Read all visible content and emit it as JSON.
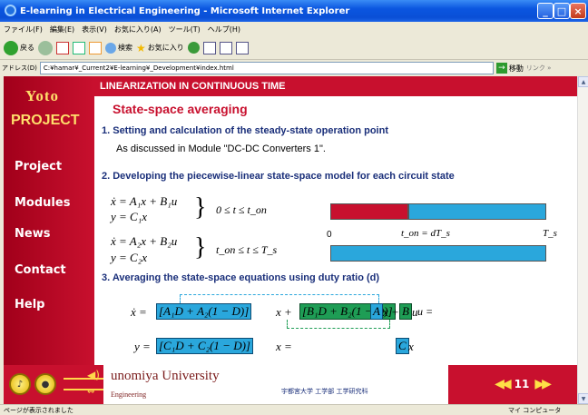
{
  "window": {
    "title": "E-learning in Electrical Engineering - Microsoft Internet Explorer"
  },
  "menu": [
    "ファイル(F)",
    "編集(E)",
    "表示(V)",
    "お気に入り(A)",
    "ツール(T)",
    "ヘルプ(H)"
  ],
  "toolbar": {
    "back": "戻る",
    "search": "検索",
    "favorites": "お気に入り"
  },
  "address": {
    "label": "アドレス(D)",
    "value": "C:¥hamar¥_Current2¥E-learning¥_Development¥index.html",
    "go": "移動",
    "links": "リンク »"
  },
  "status": {
    "left": "ページが表示されました",
    "right": "マイ コンピュータ"
  },
  "sidebar": {
    "logo_top": "Yoto",
    "logo_bottom": "PROJECT",
    "items": [
      "Project",
      "Modules",
      "News",
      "Contact",
      "Help"
    ]
  },
  "page": {
    "header": "LINEARIZATION IN CONTINUOUS TIME",
    "title": "State-space averaging",
    "s1": "1. Setting and calculation of the steady-state operation point",
    "s1_text": "As discussed in Module \"DC-DC Converters 1\".",
    "s2": "2. Developing the piecewise-linear state-space model for each circuit state",
    "eq1a": "ẋ = A₁x + B₁u",
    "eq1b": "y = C₁x",
    "cond1": "0 ≤ t ≤ t_on",
    "eq2a": "ẋ = A₂x + B₂u",
    "eq2b": "y = C₂x",
    "cond2": "t_on ≤ t ≤ T_s",
    "tl_zero": "0",
    "tl_ton": "t_on = dT_s",
    "tl_ts": "T_s",
    "s3": "3. Averaging the state-space equations using duty ratio (d)",
    "avg_x": "ẋ =",
    "avg_a": "[A₁D + A₂(1 − D)]",
    "avg_xplus": "x +",
    "avg_b": "[B₁D + B₂(1 − D)]",
    "avg_u": "u =",
    "avg_A": "A",
    "avg_x2": "x +",
    "avg_B": "B",
    "avg_u2": "u",
    "avg_y": "y =",
    "avg_c": "[C₁D + C₂(1 − D)]",
    "avg_x3": "x =",
    "avg_C": "C",
    "avg_x4": "x"
  },
  "footer": {
    "university": "unomiya University",
    "dept": "Engineering",
    "jp": "宇都宮大学 工学部 工学研究科",
    "page": "11"
  },
  "colors": {
    "accent": "#c8102e",
    "cyan": "#2aa7dc",
    "green": "#1e9d55",
    "red": "#c8102e"
  }
}
